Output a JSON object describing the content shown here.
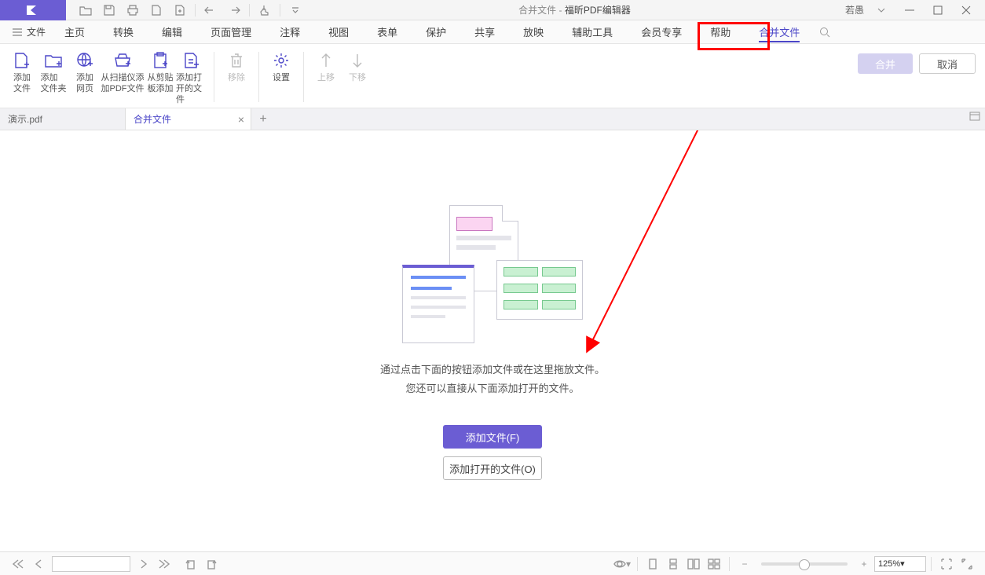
{
  "title": {
    "doc": "合并文件",
    "app": "福昕PDF编辑器"
  },
  "user": "若愚",
  "menu": {
    "file": "文件",
    "items": [
      "主页",
      "转换",
      "编辑",
      "页面管理",
      "注释",
      "视图",
      "表单",
      "保护",
      "共享",
      "放映",
      "辅助工具",
      "会员专享",
      "帮助",
      "合并文件"
    ]
  },
  "ribbon": {
    "addFile": "添加\n文件",
    "addFolder": "添加\n文件夹",
    "addWeb": "添加\n网页",
    "addScan": "从扫描仪添\n加PDF文件",
    "addClip": "从剪贴\n板添加",
    "addOpen": "添加打\n开的文件",
    "remove": "移除",
    "settings": "设置",
    "moveUp": "上移",
    "moveDown": "下移",
    "merge": "合并",
    "cancel": "取消"
  },
  "tabs": {
    "t1": "演示.pdf",
    "t2": "合并文件"
  },
  "content": {
    "hint1": "通过点击下面的按钮添加文件或在这里拖放文件。",
    "hint2": "您还可以直接从下面添加打开的文件。",
    "addFilesBtn": "添加文件(F)",
    "addOpenBtn": "添加打开的文件(O)"
  },
  "status": {
    "zoom": "125%"
  }
}
